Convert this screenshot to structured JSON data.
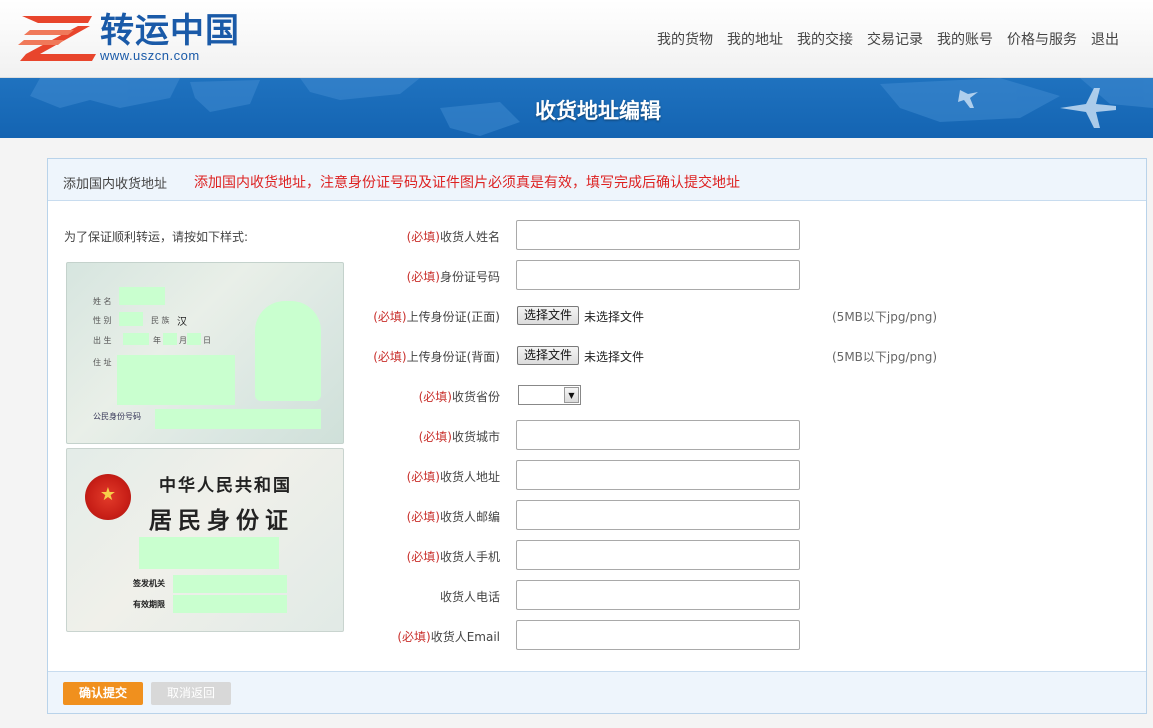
{
  "header": {
    "logo_cn": "转运中国",
    "logo_url": "www.uszcn.com",
    "nav": [
      "我的货物",
      "我的地址",
      "我的交接",
      "交易记录",
      "我的账号",
      "价格与服务",
      "退出"
    ]
  },
  "banner": {
    "title": "收货地址编辑"
  },
  "panel": {
    "title": "添加国内收货地址",
    "notice": "添加国内收货地址，注意身份证号码及证件图片必须真是有效，填写完成后确认提交地址"
  },
  "sample": {
    "hint": "为了保证顺利转运，请按如下样式:",
    "front": {
      "name_label": "姓 名",
      "gender_label": "性 别",
      "ethnic_label": "民 族",
      "ethnic_value": "汉",
      "birth_label": "出 生",
      "year_label": "年",
      "month_label": "月",
      "day_label": "日",
      "address_label": "住 址",
      "idno_label": "公民身份号码"
    },
    "back": {
      "country": "中华人民共和国",
      "title": "居民身份证",
      "authority_label": "签发机关",
      "valid_label": "有效期限"
    }
  },
  "form": {
    "required_tag": "(必填)",
    "name_label": "收货人姓名",
    "idno_label": "身份证号码",
    "upload_front_label": "上传身份证(正面)",
    "upload_back_label": "上传身份证(背面)",
    "file_button": "选择文件",
    "file_status": "未选择文件",
    "file_hint": "(5MB以下jpg/png)",
    "province_label": "收货省份",
    "city_label": "收货城市",
    "address_label": "收货人地址",
    "zip_label": "收货人邮编",
    "mobile_label": "收货人手机",
    "phone_label": "收货人电话",
    "email_label": "收货人Email"
  },
  "actions": {
    "submit": "确认提交",
    "cancel": "取消返回"
  },
  "colors": {
    "brand_blue": "#1a5aa8",
    "banner_blue": "#1f72bf",
    "required_red": "#c9302c",
    "submit_orange": "#f0901e"
  }
}
